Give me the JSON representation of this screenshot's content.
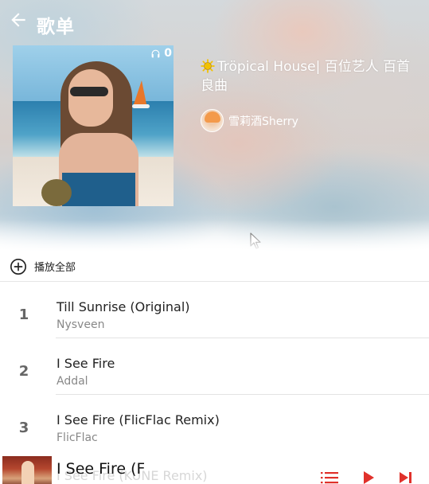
{
  "header": {
    "title": "歌单",
    "back_icon": "arrow-left-icon"
  },
  "playlist": {
    "play_count": "0",
    "title": "Tröpical House| 百位艺人 百首良曲",
    "author": "雪莉酒Sherry"
  },
  "play_all": {
    "label": "播放全部",
    "icon": "plus-circle-icon"
  },
  "songs": [
    {
      "index": "1",
      "name": "Till Sunrise (Original)",
      "artist": "Nysveen"
    },
    {
      "index": "2",
      "name": "I See Fire",
      "artist": "Addal"
    },
    {
      "index": "3",
      "name": "I See Fire (FlicFlac Remix)",
      "artist": "FlicFlac"
    }
  ],
  "mini_player": {
    "title": "I See Fire (Fli",
    "ghost_title": "I See Fire (KUNE Remix)",
    "icons": [
      "playlist-icon",
      "play-icon",
      "next-icon"
    ]
  },
  "colors": {
    "accent": "#e0312b",
    "header_text": "#ffffff",
    "sun": "#f2c200"
  }
}
